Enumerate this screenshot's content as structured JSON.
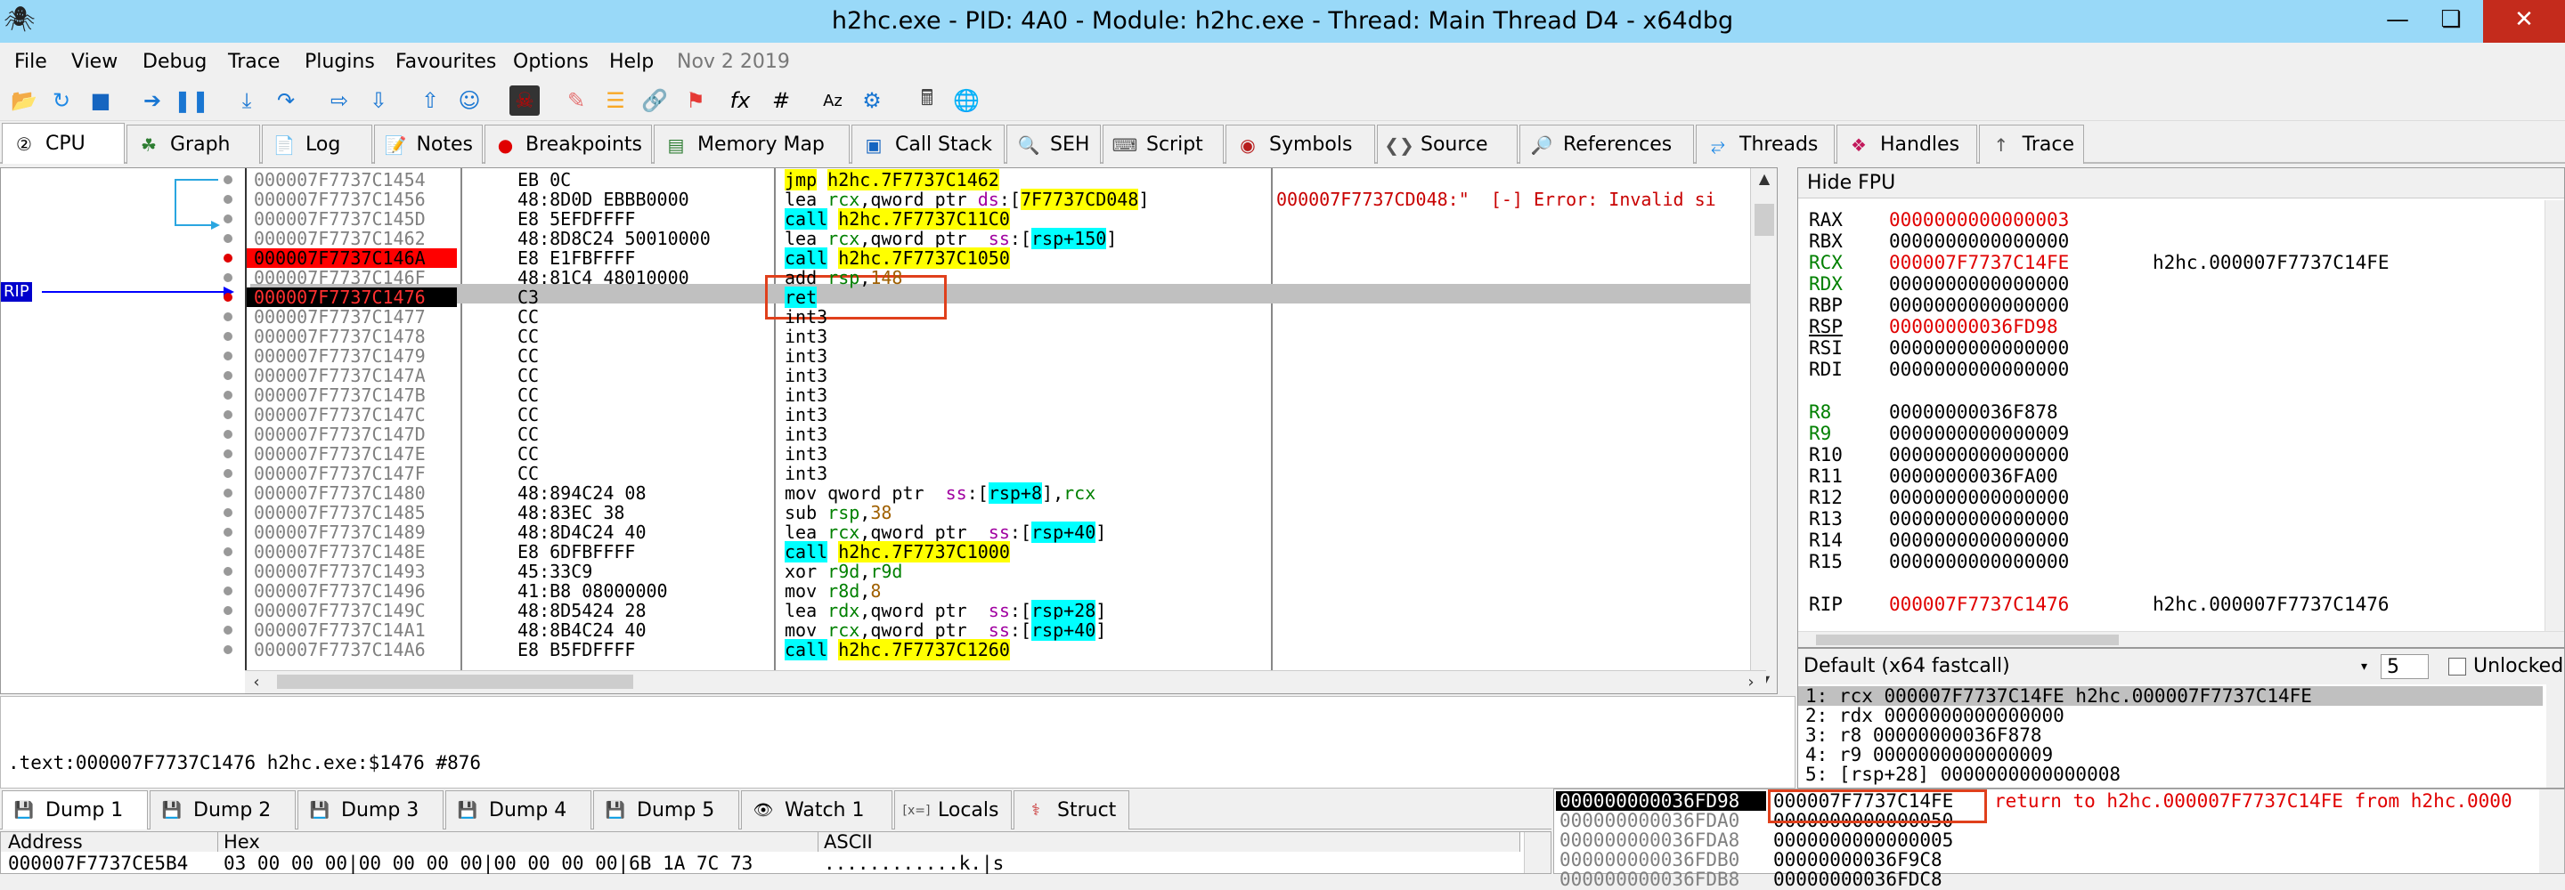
{
  "window": {
    "title": "h2hc.exe - PID: 4A0 - Module: h2hc.exe - Thread: Main Thread D4 - x64dbg",
    "minimize": "—",
    "maximize": "❏",
    "close": "✕"
  },
  "menu": {
    "items": [
      "File",
      "View",
      "Debug",
      "Trace",
      "Plugins",
      "Favourites",
      "Options",
      "Help"
    ],
    "date": "Nov 2 2019"
  },
  "tabs": [
    {
      "label": "CPU",
      "icon": "cpu-icon"
    },
    {
      "label": "Graph",
      "icon": "graph-icon"
    },
    {
      "label": "Log",
      "icon": "log-icon"
    },
    {
      "label": "Notes",
      "icon": "notes-icon"
    },
    {
      "label": "Breakpoints",
      "icon": "breakpoint-icon"
    },
    {
      "label": "Memory Map",
      "icon": "memory-icon"
    },
    {
      "label": "Call Stack",
      "icon": "callstack-icon"
    },
    {
      "label": "SEH",
      "icon": "seh-icon"
    },
    {
      "label": "Script",
      "icon": "script-icon"
    },
    {
      "label": "Symbols",
      "icon": "symbols-icon"
    },
    {
      "label": "Source",
      "icon": "source-icon"
    },
    {
      "label": "References",
      "icon": "references-icon"
    },
    {
      "label": "Threads",
      "icon": "threads-icon"
    },
    {
      "label": "Handles",
      "icon": "handles-icon"
    },
    {
      "label": "Trace",
      "icon": "trace-icon"
    }
  ],
  "rip_label": "RIP",
  "disasm": [
    {
      "addr": "000007F7737C1454",
      "bytes": "EB 0C",
      "instr": [
        [
          "jmp",
          "hl-y"
        ],
        [
          " "
        ],
        [
          "h2hc.7F7737C1462",
          "hl-y"
        ]
      ],
      "cmt": ""
    },
    {
      "addr": "000007F7737C1456",
      "bytes": "48:8D0D EBBB0000",
      "instr": [
        [
          "lea "
        ],
        [
          "rcx",
          "reg"
        ],
        [
          ",qword ptr "
        ],
        [
          "ds",
          "seg"
        ],
        [
          ":["
        ],
        [
          "7F7737CD048",
          "hl-y"
        ],
        [
          "]"
        ]
      ],
      "cmt": "000007F7737CD048:\"  [-] Error: Invalid si"
    },
    {
      "addr": "000007F7737C145D",
      "bytes": "E8 5EFDFFFF",
      "instr": [
        [
          "call",
          "hl-c"
        ],
        [
          " "
        ],
        [
          "h2hc.7F7737C11C0",
          "hl-y"
        ]
      ],
      "cmt": ""
    },
    {
      "addr": "000007F7737C1462",
      "bytes": "48:8D8C24 50010000",
      "instr": [
        [
          "lea "
        ],
        [
          "rcx",
          "reg"
        ],
        [
          ",qword ptr  "
        ],
        [
          "ss",
          "seg"
        ],
        [
          ":["
        ],
        [
          "rsp+150",
          "hl-c"
        ],
        [
          "]"
        ]
      ],
      "cmt": ""
    },
    {
      "addr": "000007F7737C146A",
      "bytes": "E8 E1FBFFFF",
      "instr": [
        [
          "call",
          "hl-c"
        ],
        [
          " "
        ],
        [
          "h2hc.7F7737C1050",
          "hl-y"
        ]
      ],
      "cmt": ""
    },
    {
      "addr": "000007F7737C146F",
      "bytes": "48:81C4 48010000",
      "instr": [
        [
          "add "
        ],
        [
          "rsp",
          "reg"
        ],
        [
          ","
        ],
        [
          "148",
          "num"
        ]
      ],
      "cmt": ""
    },
    {
      "addr": "000007F7737C1476",
      "bytes": "C3",
      "instr": [
        [
          "ret",
          "hl-c"
        ]
      ],
      "cmt": ""
    },
    {
      "addr": "000007F7737C1477",
      "bytes": "CC",
      "instr": [
        [
          "int3"
        ]
      ],
      "cmt": ""
    },
    {
      "addr": "000007F7737C1478",
      "bytes": "CC",
      "instr": [
        [
          "int3"
        ]
      ],
      "cmt": ""
    },
    {
      "addr": "000007F7737C1479",
      "bytes": "CC",
      "instr": [
        [
          "int3"
        ]
      ],
      "cmt": ""
    },
    {
      "addr": "000007F7737C147A",
      "bytes": "CC",
      "instr": [
        [
          "int3"
        ]
      ],
      "cmt": ""
    },
    {
      "addr": "000007F7737C147B",
      "bytes": "CC",
      "instr": [
        [
          "int3"
        ]
      ],
      "cmt": ""
    },
    {
      "addr": "000007F7737C147C",
      "bytes": "CC",
      "instr": [
        [
          "int3"
        ]
      ],
      "cmt": ""
    },
    {
      "addr": "000007F7737C147D",
      "bytes": "CC",
      "instr": [
        [
          "int3"
        ]
      ],
      "cmt": ""
    },
    {
      "addr": "000007F7737C147E",
      "bytes": "CC",
      "instr": [
        [
          "int3"
        ]
      ],
      "cmt": ""
    },
    {
      "addr": "000007F7737C147F",
      "bytes": "CC",
      "instr": [
        [
          "int3"
        ]
      ],
      "cmt": ""
    },
    {
      "addr": "000007F7737C1480",
      "bytes": "48:894C24 08",
      "instr": [
        [
          "mov qword ptr  "
        ],
        [
          "ss",
          "seg"
        ],
        [
          ":["
        ],
        [
          "rsp+8",
          "hl-c"
        ],
        [
          "],"
        ],
        [
          "rcx",
          "reg"
        ]
      ],
      "cmt": ""
    },
    {
      "addr": "000007F7737C1485",
      "bytes": "48:83EC 38",
      "instr": [
        [
          "sub "
        ],
        [
          "rsp",
          "reg"
        ],
        [
          ","
        ],
        [
          "38",
          "num"
        ]
      ],
      "cmt": ""
    },
    {
      "addr": "000007F7737C1489",
      "bytes": "48:8D4C24 40",
      "instr": [
        [
          "lea "
        ],
        [
          "rcx",
          "reg"
        ],
        [
          ",qword ptr  "
        ],
        [
          "ss",
          "seg"
        ],
        [
          ":["
        ],
        [
          "rsp+40",
          "hl-c"
        ],
        [
          "]"
        ]
      ],
      "cmt": ""
    },
    {
      "addr": "000007F7737C148E",
      "bytes": "E8 6DFBFFFF",
      "instr": [
        [
          "call",
          "hl-c"
        ],
        [
          " "
        ],
        [
          "h2hc.7F7737C1000",
          "hl-y"
        ]
      ],
      "cmt": ""
    },
    {
      "addr": "000007F7737C1493",
      "bytes": "45:33C9",
      "instr": [
        [
          "xor "
        ],
        [
          "r9d",
          "reg"
        ],
        [
          ","
        ],
        [
          "r9d",
          "reg"
        ]
      ],
      "cmt": ""
    },
    {
      "addr": "000007F7737C1496",
      "bytes": "41:B8 08000000",
      "instr": [
        [
          "mov "
        ],
        [
          "r8d",
          "reg"
        ],
        [
          ","
        ],
        [
          "8",
          "num"
        ]
      ],
      "cmt": ""
    },
    {
      "addr": "000007F7737C149C",
      "bytes": "48:8D5424 28",
      "instr": [
        [
          "lea "
        ],
        [
          "rdx",
          "reg"
        ],
        [
          ",qword ptr  "
        ],
        [
          "ss",
          "seg"
        ],
        [
          ":["
        ],
        [
          "rsp+28",
          "hl-c"
        ],
        [
          "]"
        ]
      ],
      "cmt": ""
    },
    {
      "addr": "000007F7737C14A1",
      "bytes": "48:8B4C24 40",
      "instr": [
        [
          "mov "
        ],
        [
          "rcx",
          "reg"
        ],
        [
          ",qword ptr  "
        ],
        [
          "ss",
          "seg"
        ],
        [
          ":["
        ],
        [
          "rsp+40",
          "hl-c"
        ],
        [
          "]"
        ]
      ],
      "cmt": ""
    },
    {
      "addr": "000007F7737C14A6",
      "bytes": "E8 B5FDFFFF",
      "instr": [
        [
          "call",
          "hl-c"
        ],
        [
          " "
        ],
        [
          "h2hc.7F7737C1260",
          "hl-y"
        ]
      ],
      "cmt": ""
    }
  ],
  "registers": {
    "header": "Hide FPU",
    "rows": [
      {
        "n": "RAX",
        "v": "0000000000000003",
        "c": "",
        "chg": true
      },
      {
        "n": "RBX",
        "v": "0000000000000000",
        "c": "",
        "chg": false
      },
      {
        "n": "RCX",
        "v": "000007F7737C14FE",
        "c": "h2hc.000007F7737C14FE",
        "chg": true,
        "green": true
      },
      {
        "n": "RDX",
        "v": "0000000000000000",
        "c": "",
        "chg": false,
        "green": true
      },
      {
        "n": "RBP",
        "v": "0000000000000000",
        "c": "",
        "chg": false
      },
      {
        "n": "RSP",
        "v": "00000000036FD98",
        "c": "",
        "chg": true,
        "underline": true
      },
      {
        "n": "RSI",
        "v": "0000000000000000",
        "c": "",
        "chg": false
      },
      {
        "n": "RDI",
        "v": "0000000000000000",
        "c": "",
        "chg": false
      },
      {
        "n": "",
        "v": "",
        "c": "",
        "chg": false
      },
      {
        "n": "R8",
        "v": "00000000036F878",
        "c": "",
        "chg": false,
        "green": true
      },
      {
        "n": "R9",
        "v": "0000000000000009",
        "c": "",
        "chg": false,
        "green": true
      },
      {
        "n": "R10",
        "v": "0000000000000000",
        "c": "",
        "chg": false
      },
      {
        "n": "R11",
        "v": "00000000036FA00",
        "c": "",
        "chg": false
      },
      {
        "n": "R12",
        "v": "0000000000000000",
        "c": "",
        "chg": false
      },
      {
        "n": "R13",
        "v": "0000000000000000",
        "c": "",
        "chg": false
      },
      {
        "n": "R14",
        "v": "0000000000000000",
        "c": "",
        "chg": false
      },
      {
        "n": "R15",
        "v": "0000000000000000",
        "c": "",
        "chg": false
      },
      {
        "n": "",
        "v": "",
        "c": "",
        "chg": false
      },
      {
        "n": "RIP",
        "v": "000007F7737C1476",
        "c": "h2hc.000007F7737C1476",
        "chg": true
      }
    ]
  },
  "callconv": {
    "label": "Default (x64 fastcall)",
    "count": "5",
    "unlocked": "Unlocked",
    "rows": [
      "1: rcx 000007F7737C14FE h2hc.000007F7737C14FE",
      "2: rdx 0000000000000000",
      "3: r8 00000000036F878",
      "4: r9 0000000000000009",
      "5: [rsp+28] 0000000000000008"
    ]
  },
  "infobar": {
    "text": ".text:000007F7737C1476 h2hc.exe:$1476 #876"
  },
  "bottom_tabs": [
    {
      "label": "Dump 1",
      "icon": "dump-icon"
    },
    {
      "label": "Dump 2",
      "icon": "dump-icon"
    },
    {
      "label": "Dump 3",
      "icon": "dump-icon"
    },
    {
      "label": "Dump 4",
      "icon": "dump-icon"
    },
    {
      "label": "Dump 5",
      "icon": "dump-icon"
    },
    {
      "label": "Watch 1",
      "icon": "watch-icon"
    },
    {
      "label": "Locals",
      "icon": "locals-icon"
    },
    {
      "label": "Struct",
      "icon": "struct-icon"
    }
  ],
  "dump": {
    "col_address": "Address",
    "col_hex": "Hex",
    "col_ascii": "ASCII",
    "row_addr": "000007F7737CE5B4",
    "row_hex": "03 00 00 00|00 00 00 00|00 00 00 00|6B 1A 7C 73",
    "row_ascii": "............k.|s"
  },
  "stack": {
    "addrs": [
      "000000000036FD98",
      "000000000036FDA0",
      "000000000036FDA8",
      "000000000036FDB0",
      "000000000036FDB8"
    ],
    "vals": [
      "000007F7737C14FE",
      "0000000000000050",
      "0000000000000005",
      "00000000036F9C8",
      "00000000036FDC8"
    ],
    "cmt0": "return to h2hc.000007F7737C14FE from h2hc.0000"
  },
  "colors": {
    "accent": "#99d9f8",
    "rip": "#0000ff",
    "bp": "#e00000"
  }
}
